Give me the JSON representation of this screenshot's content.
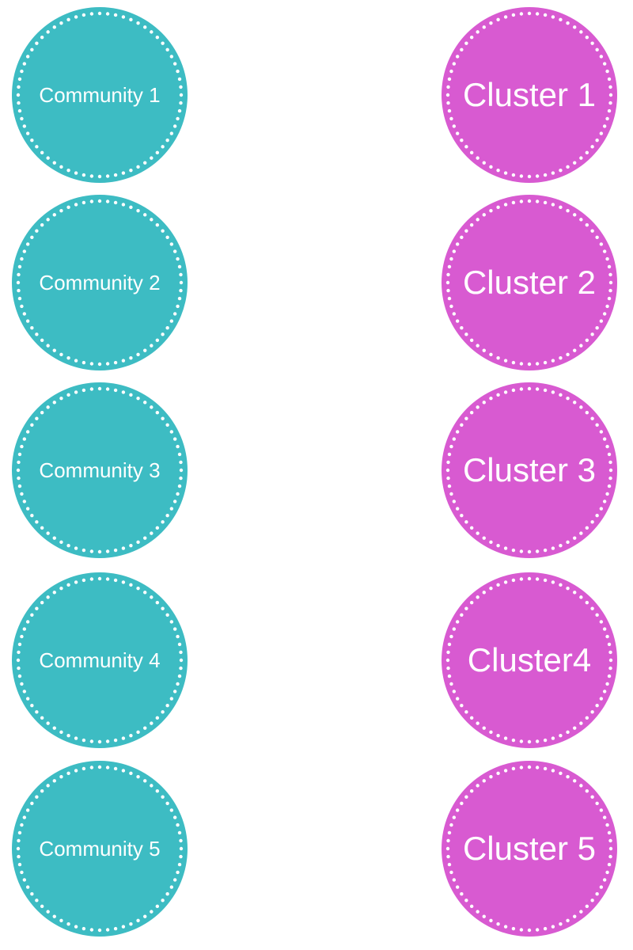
{
  "colors": {
    "community": "#3dbcc3",
    "cluster": "#d85ad1",
    "dots": "#ffffff"
  },
  "communities": [
    {
      "label": "Community 1"
    },
    {
      "label": "Community 2"
    },
    {
      "label": "Community 3"
    },
    {
      "label": "Community 4"
    },
    {
      "label": "Community 5"
    }
  ],
  "clusters": [
    {
      "label": "Cluster 1"
    },
    {
      "label": "Cluster 2"
    },
    {
      "label": "Cluster 3"
    },
    {
      "label": "Cluster4"
    },
    {
      "label": "Cluster 5"
    }
  ]
}
